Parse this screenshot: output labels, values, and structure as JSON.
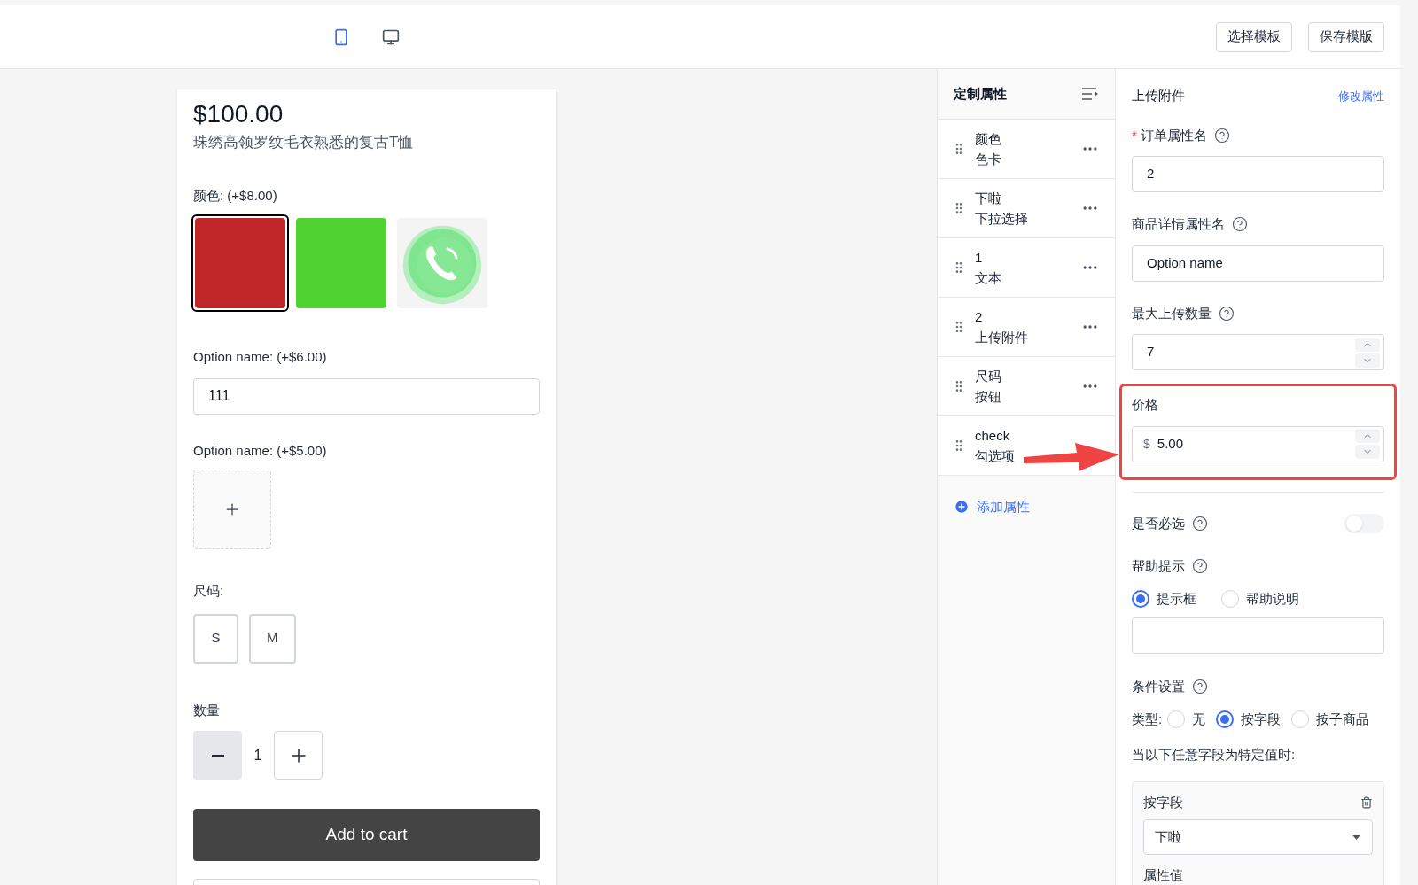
{
  "header": {
    "device_tabs": [
      {
        "kind": "mobile",
        "selected": true
      },
      {
        "kind": "desktop",
        "selected": false
      }
    ],
    "buttons": [
      "选择模板",
      "保存模版"
    ]
  },
  "preview": {
    "price": "$100.00",
    "title": "珠绣高领罗纹毛衣熟悉的复古T恤",
    "color_option": {
      "label": "颜色:",
      "extra": "(+$8.00)",
      "swatches": [
        {
          "kind": "color",
          "color": "#bf2728",
          "selected": true
        },
        {
          "kind": "color",
          "color": "#4fd232",
          "selected": false
        },
        {
          "kind": "picture",
          "selected": false
        }
      ]
    },
    "text_option": {
      "label": "Option name:",
      "extra": "(+$6.00)",
      "value": "111"
    },
    "upload_option": {
      "label": "Option name:",
      "extra": "(+$5.00)"
    },
    "size_option": {
      "label": "尺码:",
      "sizes": [
        {
          "label": "S",
          "selected": false
        },
        {
          "label": "M",
          "selected": false
        }
      ]
    },
    "quantity": {
      "label": "数量",
      "value": "1"
    },
    "add_to_cart": "Add to cart"
  },
  "attributes": {
    "title": "定制属性",
    "items": [
      {
        "name": "颜色",
        "type": "色卡"
      },
      {
        "name": "下啦",
        "type": "下拉选择"
      },
      {
        "name": "1",
        "type": "文本"
      },
      {
        "name": "2",
        "type": "上传附件"
      },
      {
        "name": "尺码",
        "type": "按钮"
      },
      {
        "name": "check",
        "type": "勾选项"
      }
    ],
    "add": "添加属性"
  },
  "settings": {
    "title": "上传附件",
    "edit_link": "修改属性",
    "order_name": {
      "required_mark": "*",
      "label": "订单属性名",
      "value": "2"
    },
    "detail_name": {
      "label": "商品详情属性名",
      "value": "Option name"
    },
    "max_uploads": {
      "label": "最大上传数量",
      "value": "7"
    },
    "price": {
      "label": "价格",
      "prefix": "$",
      "value": "5.00"
    },
    "required_toggle": {
      "label": "是否必选",
      "on": false
    },
    "help_tip": {
      "label": "帮助提示",
      "options": [
        {
          "label": "提示框",
          "selected": true
        },
        {
          "label": "帮助说明",
          "selected": false
        }
      ]
    },
    "condition": {
      "label": "条件设置",
      "type_label": "类型:",
      "options": [
        {
          "label": "无",
          "selected": false
        },
        {
          "label": "按字段",
          "selected": true
        },
        {
          "label": "按子商品",
          "selected": false
        }
      ],
      "note": "当以下任意字段为特定值时:",
      "card": {
        "title": "按字段",
        "select_value": "下啦",
        "value_label": "属性值"
      }
    }
  }
}
